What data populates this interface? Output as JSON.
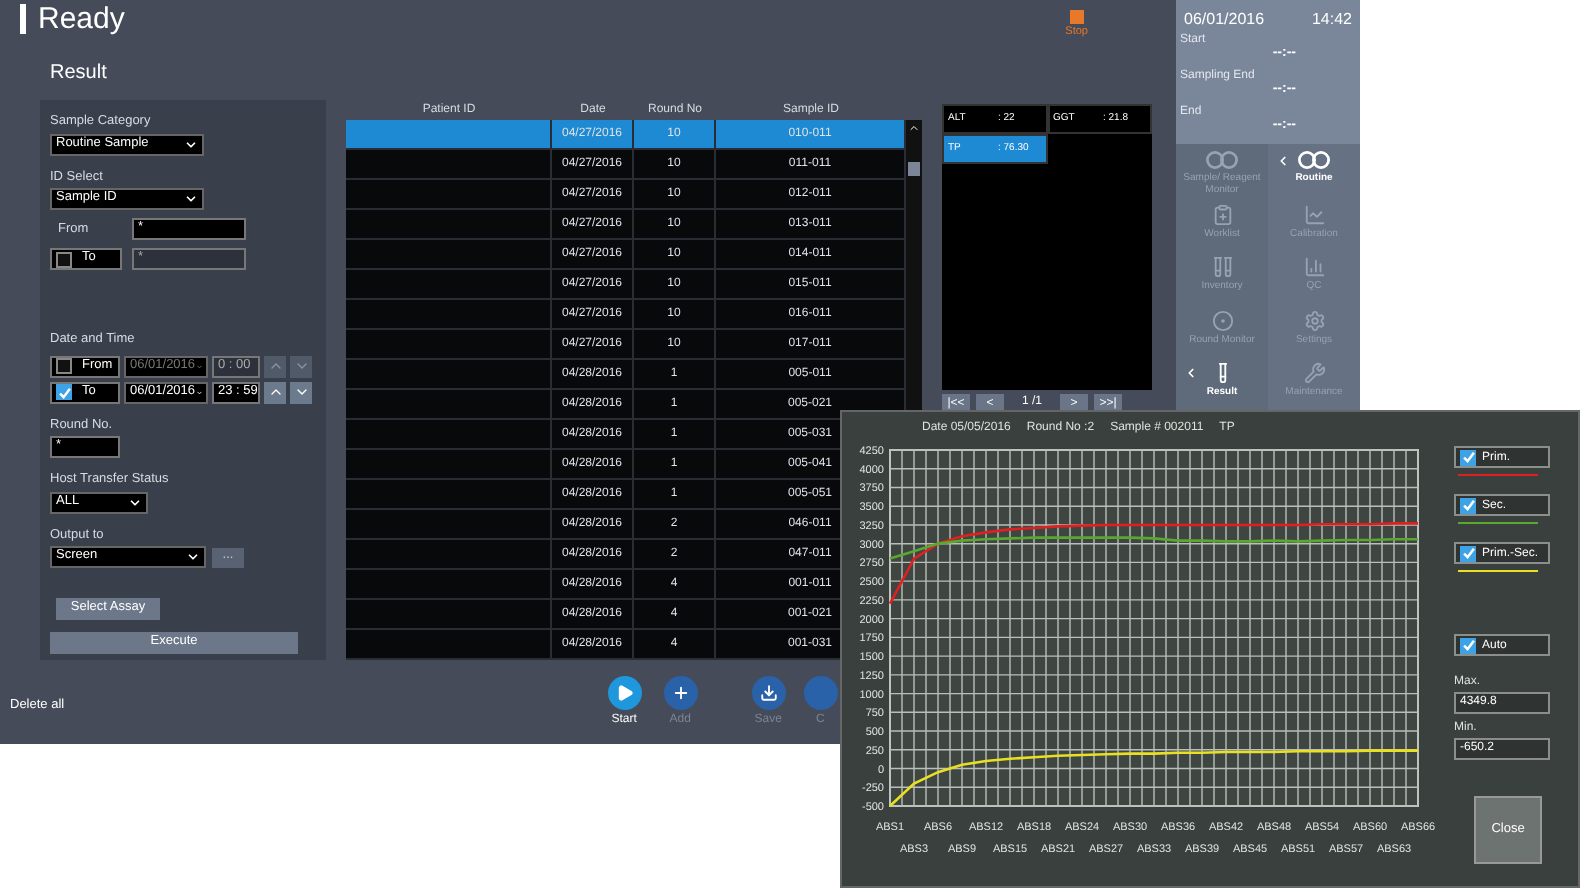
{
  "header": {
    "status": "Ready",
    "stop_label": "Stop"
  },
  "page_title": "Result",
  "filter": {
    "sample_category": {
      "label": "Sample Category",
      "value": "Routine Sample"
    },
    "id_select": {
      "label": "ID Select",
      "value": "Sample ID"
    },
    "id_from": {
      "label": "From",
      "value": "*"
    },
    "id_to": {
      "label": "To",
      "checked": false,
      "value": "*"
    },
    "date_time_label": "Date and Time",
    "date_rows": [
      {
        "label": "From",
        "checked": false,
        "date": "06/01/2016",
        "time": "0 : 00"
      },
      {
        "label": "To",
        "checked": true,
        "date": "06/01/2016",
        "time": "23 : 59"
      }
    ],
    "round_no": {
      "label": "Round No.",
      "value": "*"
    },
    "host_transfer": {
      "label": "Host Transfer Status",
      "value": "ALL"
    },
    "output_to": {
      "label": "Output to",
      "value": "Screen",
      "more": "..."
    },
    "select_assay": "Select Assay",
    "execute": "Execute"
  },
  "delete_all": "Delete all",
  "table": {
    "columns": [
      "Patient ID",
      "Date",
      "Round No",
      "Sample ID"
    ],
    "rows": [
      {
        "patient_id": "",
        "date": "04/27/2016",
        "round_no": "10",
        "sample_id": "010-011",
        "selected": true
      },
      {
        "date": "04/27/2016",
        "round_no": "10",
        "sample_id": "011-011",
        "selected": false
      },
      {
        "date": "04/27/2016",
        "round_no": "10",
        "sample_id": "012-011",
        "selected": false
      },
      {
        "date": "04/27/2016",
        "round_no": "10",
        "sample_id": "013-011",
        "selected": false
      },
      {
        "date": "04/27/2016",
        "round_no": "10",
        "sample_id": "014-011",
        "selected": false
      },
      {
        "date": "04/27/2016",
        "round_no": "10",
        "sample_id": "015-011",
        "selected": false
      },
      {
        "date": "04/27/2016",
        "round_no": "10",
        "sample_id": "016-011",
        "selected": false
      },
      {
        "date": "04/27/2016",
        "round_no": "10",
        "sample_id": "017-011",
        "selected": false
      },
      {
        "date": "04/28/2016",
        "round_no": "1",
        "sample_id": "005-011",
        "selected": false
      },
      {
        "date": "04/28/2016",
        "round_no": "1",
        "sample_id": "005-021",
        "selected": false
      },
      {
        "date": "04/28/2016",
        "round_no": "1",
        "sample_id": "005-031",
        "selected": false
      },
      {
        "date": "04/28/2016",
        "round_no": "1",
        "sample_id": "005-041",
        "selected": false
      },
      {
        "date": "04/28/2016",
        "round_no": "1",
        "sample_id": "005-051",
        "selected": false
      },
      {
        "date": "04/28/2016",
        "round_no": "2",
        "sample_id": "046-011",
        "selected": false
      },
      {
        "date": "04/28/2016",
        "round_no": "2",
        "sample_id": "047-011",
        "selected": false
      },
      {
        "date": "04/28/2016",
        "round_no": "4",
        "sample_id": "001-011",
        "selected": false
      },
      {
        "date": "04/28/2016",
        "round_no": "4",
        "sample_id": "001-021",
        "selected": false
      },
      {
        "date": "04/28/2016",
        "round_no": "4",
        "sample_id": "001-031",
        "selected": false
      }
    ]
  },
  "results": [
    {
      "name": "ALT",
      "value": ": 22",
      "selected": false
    },
    {
      "name": "GGT",
      "value": ": 21.8",
      "selected": false
    },
    {
      "name": "TP",
      "value": ": 76.30",
      "selected": true
    }
  ],
  "pagination": {
    "first": "|<<",
    "prev": "<",
    "page": "1 /1",
    "next": ">",
    "last": ">>|"
  },
  "toolbar": [
    {
      "label": "Start",
      "disabled": false
    },
    {
      "label": "Add",
      "disabled": true
    },
    {
      "label": "Save",
      "disabled": true
    },
    {
      "label": "C",
      "disabled": true
    }
  ],
  "sidebar": {
    "date": "06/01/2016",
    "time": "14:42",
    "times": [
      {
        "label": "Start",
        "value": "--:--"
      },
      {
        "label": "Sampling End",
        "value": "--:--"
      },
      {
        "label": "End",
        "value": "--:--"
      }
    ],
    "nav": [
      {
        "label": "Sample/ Reagent Monitor",
        "selected": false
      },
      {
        "label": "Routine",
        "selected": true
      },
      {
        "label": "Worklist",
        "selected": false
      },
      {
        "label": "Calibration",
        "selected": false
      },
      {
        "label": "Inventory",
        "selected": false
      },
      {
        "label": "QC",
        "selected": false
      },
      {
        "label": "Round Monitor",
        "selected": false
      },
      {
        "label": "Settings",
        "selected": false
      },
      {
        "label": "Result",
        "selected": true
      },
      {
        "label": "Maintenance",
        "selected": false
      }
    ]
  },
  "reaction_popup": {
    "info": [
      "Date 05/05/2016",
      "Round No :2",
      "Sample # 002011",
      "TP"
    ],
    "chart_data": {
      "type": "line",
      "grid": true,
      "categories": [
        "ABS1",
        "ABS3",
        "ABS6",
        "ABS9",
        "ABS12",
        "ABS15",
        "ABS18",
        "ABS21",
        "ABS24",
        "ABS27",
        "ABS30",
        "ABS33",
        "ABS36",
        "ABS39",
        "ABS42",
        "ABS45",
        "ABS48",
        "ABS51",
        "ABS54",
        "ABS57",
        "ABS60",
        "ABS63",
        "ABS66"
      ],
      "ylim": [
        -500,
        4250
      ],
      "yticks": [
        -500,
        -250,
        0,
        250,
        500,
        750,
        1000,
        1250,
        1500,
        1750,
        2000,
        2250,
        2500,
        2750,
        3000,
        3250,
        3500,
        3750,
        4000,
        4250
      ],
      "series": [
        {
          "name": "Prim.",
          "color": "#e02020",
          "values": [
            2200,
            2800,
            3000,
            3100,
            3150,
            3190,
            3210,
            3230,
            3240,
            3250,
            3250,
            3250,
            3250,
            3250,
            3250,
            3250,
            3250,
            3250,
            3260,
            3260,
            3260,
            3270,
            3270
          ]
        },
        {
          "name": "Sec.",
          "color": "#5aa830",
          "values": [
            2800,
            2900,
            3000,
            3040,
            3060,
            3070,
            3080,
            3080,
            3080,
            3080,
            3080,
            3070,
            3040,
            3040,
            3030,
            3030,
            3040,
            3030,
            3040,
            3050,
            3050,
            3060,
            3060
          ]
        },
        {
          "name": "Prim.-Sec.",
          "color": "#e8e020",
          "values": [
            -500,
            -200,
            -50,
            50,
            100,
            130,
            150,
            170,
            180,
            190,
            200,
            200,
            210,
            210,
            220,
            220,
            220,
            230,
            230,
            230,
            240,
            240,
            240
          ]
        }
      ]
    },
    "legend": [
      {
        "checked": true
      },
      {
        "checked": true
      },
      {
        "checked": true
      }
    ],
    "auto": {
      "label": "Auto",
      "checked": true
    },
    "max": {
      "label": "Max.",
      "value": "4349.8"
    },
    "min": {
      "label": "Min.",
      "value": "-650.2"
    },
    "close": "Close"
  }
}
